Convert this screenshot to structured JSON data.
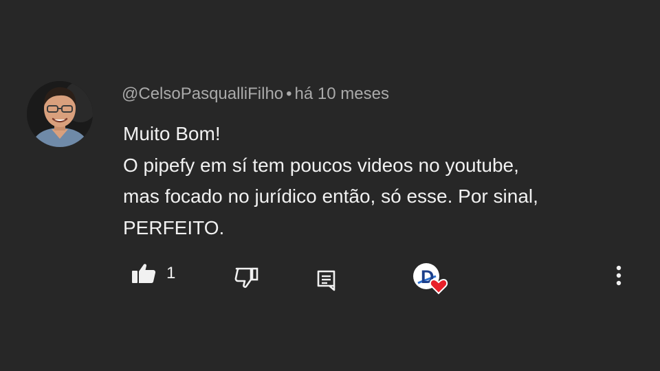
{
  "comment": {
    "author": "@CelsoPasqualliFilho",
    "separator": "•",
    "timestamp": "há 10 meses",
    "lines": [
      "Muito Bom!",
      "O pipefy em sí tem poucos videos no youtube,",
      "mas focado no jurídico então, só esse. Por sinal,",
      "PERFEITO."
    ],
    "like_count": "1",
    "creator_heart_badge_letter": "D"
  },
  "icons": {
    "like": "thumbs-up-icon",
    "dislike": "thumbs-down-icon",
    "reply": "comment-icon",
    "heart": "heart-icon",
    "more": "more-vertical-icon"
  },
  "colors": {
    "background": "#272727",
    "text_primary": "#f1f1f1",
    "text_secondary": "#aaaaaa",
    "heart": "#e8202a"
  }
}
